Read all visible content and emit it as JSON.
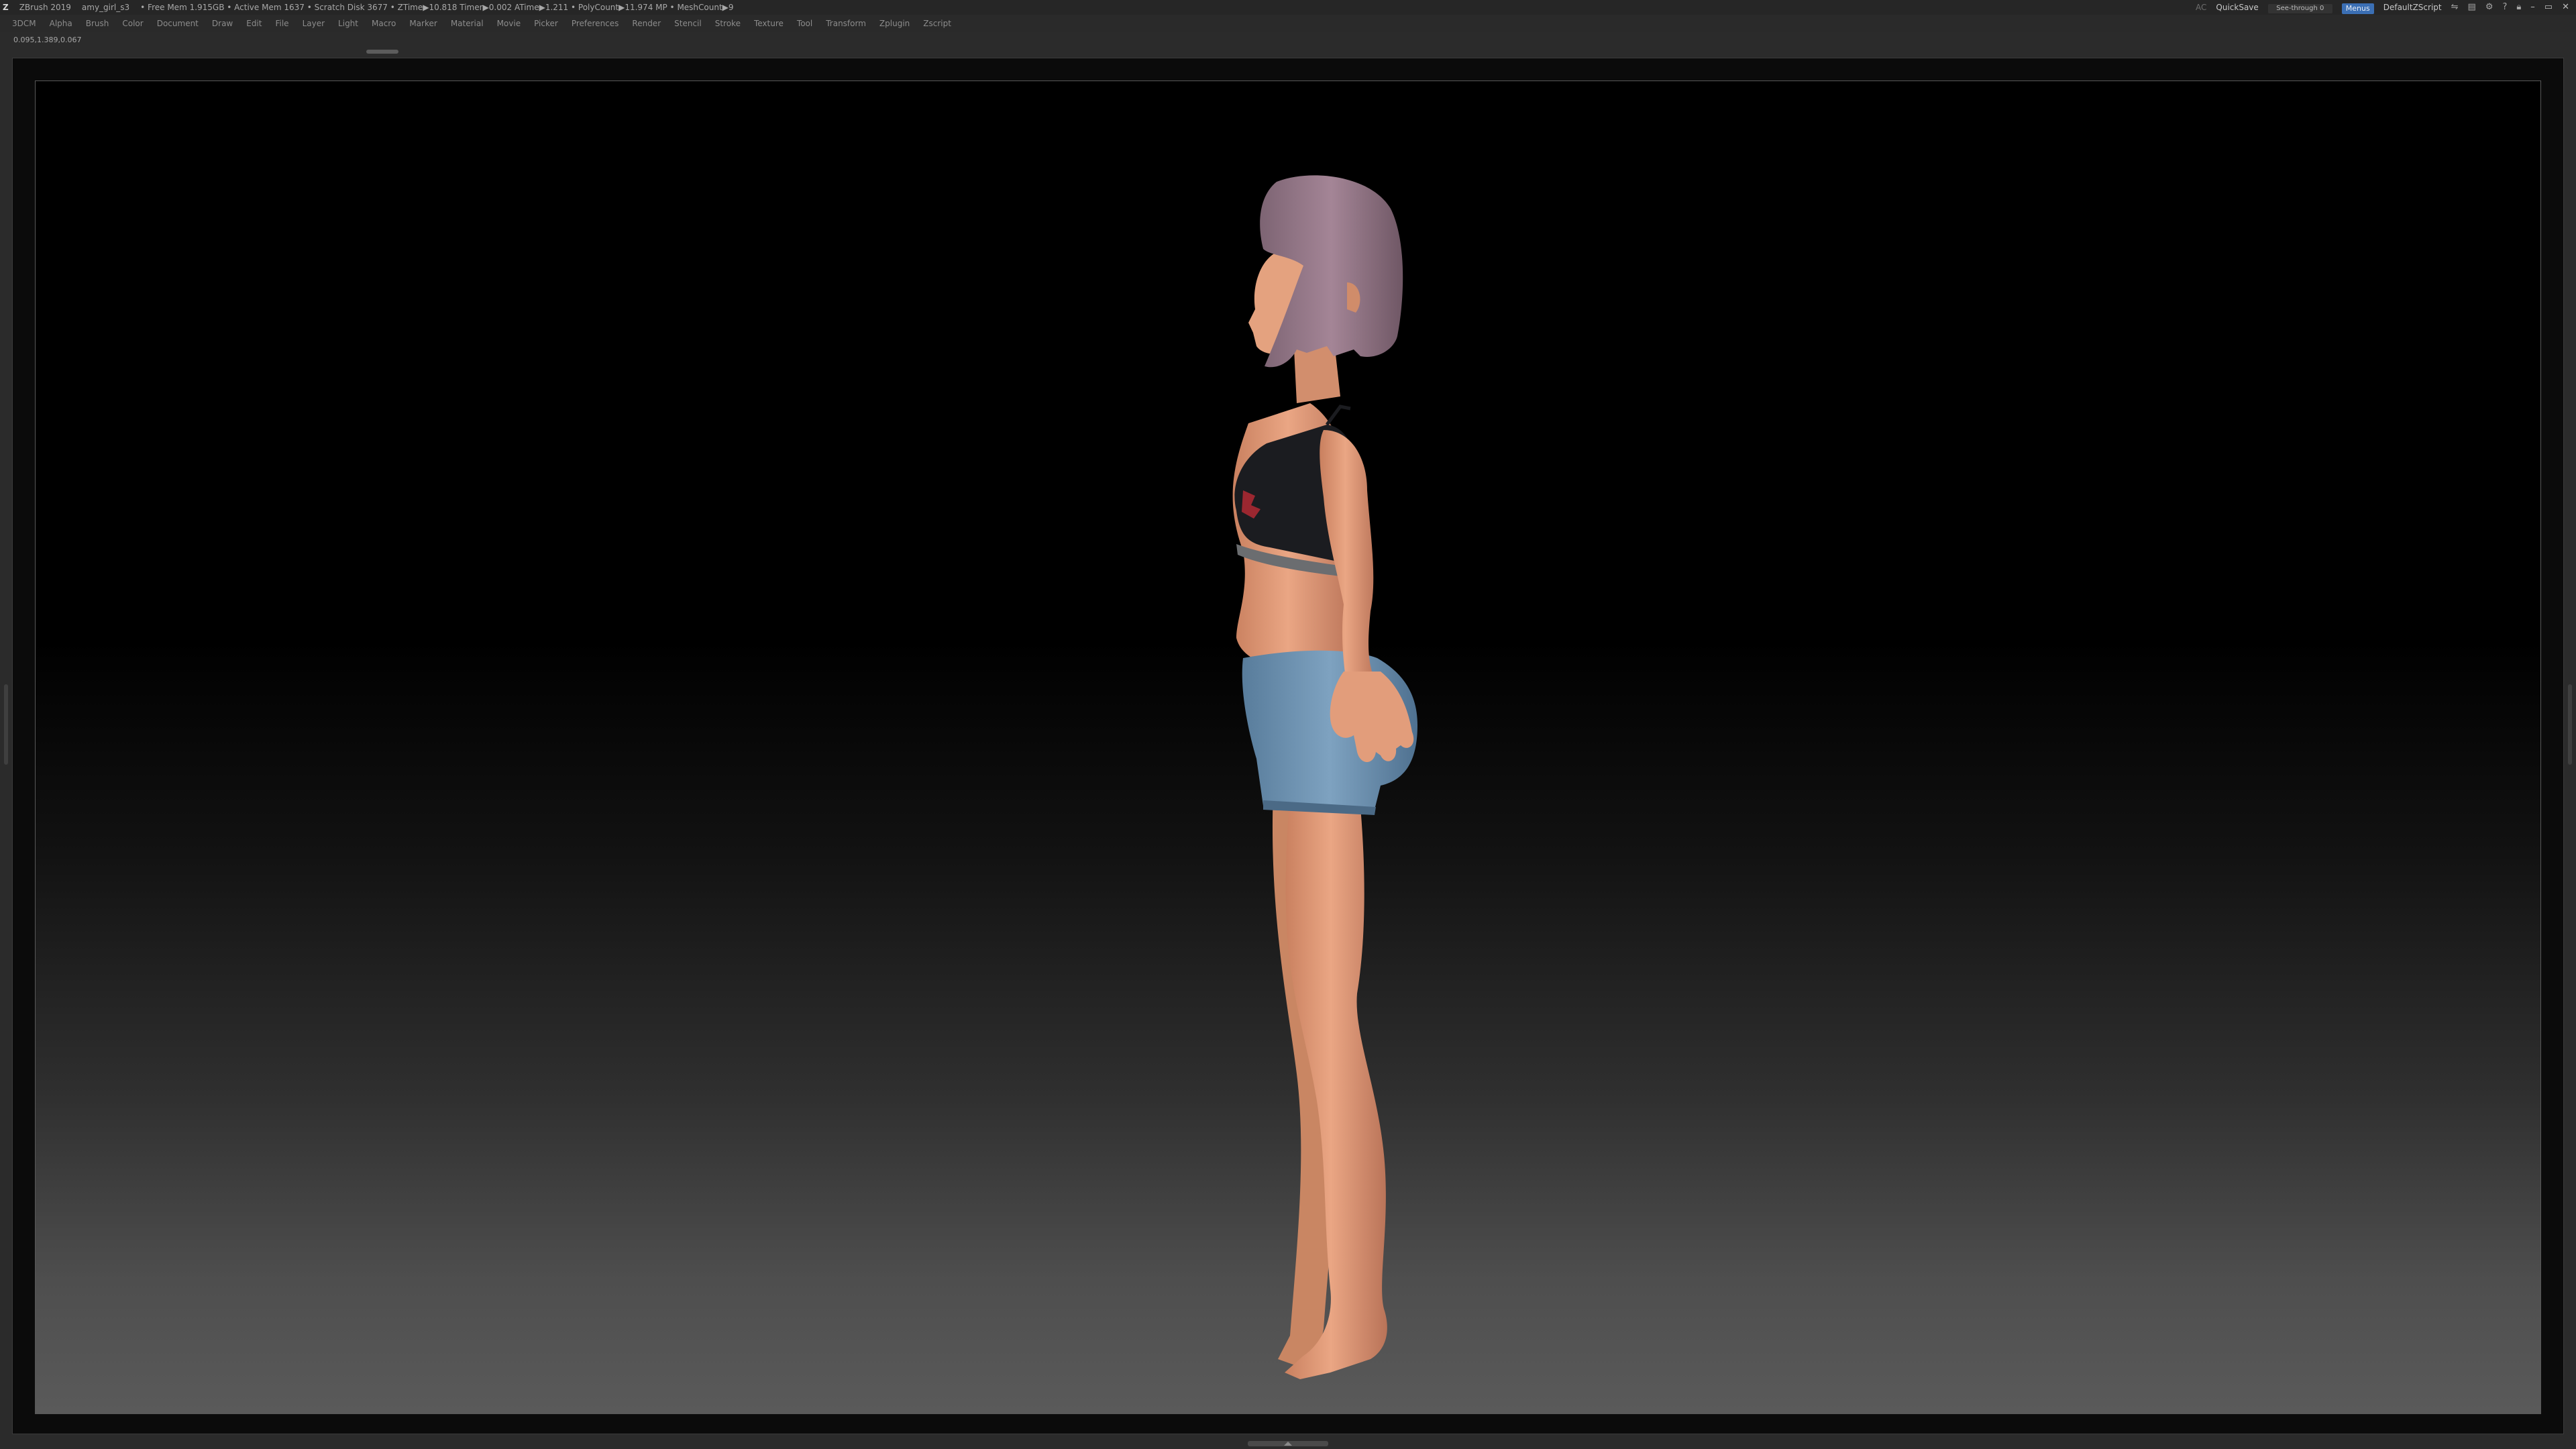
{
  "titlebar": {
    "app": "ZBrush 2019",
    "file": "amy_girl_s3",
    "stats": "• Free Mem 1.915GB • Active Mem 1637 • Scratch Disk 3677 • ZTime▶10.818 Timer▶0.002 ATime▶1.211 • PolyCount▶11.974 MP • MeshCount▶9",
    "ac_label": "AC",
    "quicksave_label": "QuickSave",
    "seethrough_label": "See-through 0",
    "seethrough_level": 0,
    "menus_label": "Menus",
    "script_label": "DefaultZScript"
  },
  "menubar": {
    "items": [
      "3DCM",
      "Alpha",
      "Brush",
      "Color",
      "Document",
      "Draw",
      "Edit",
      "File",
      "Layer",
      "Light",
      "Macro",
      "Marker",
      "Material",
      "Movie",
      "Picker",
      "Preferences",
      "Render",
      "Stencil",
      "Stroke",
      "Texture",
      "Tool",
      "Transform",
      "Zplugin",
      "Zscript"
    ]
  },
  "coordinates": "0.095,1.389,0.067",
  "viewport": {
    "background_top": "#000000",
    "background_bottom": "#5a5a5a",
    "model": "amy_girl_s3",
    "colors": {
      "skin": "#e7a07e",
      "hair": "#9a7c8e",
      "top": "#1b1c20",
      "shorts": "#6f93b1"
    }
  }
}
